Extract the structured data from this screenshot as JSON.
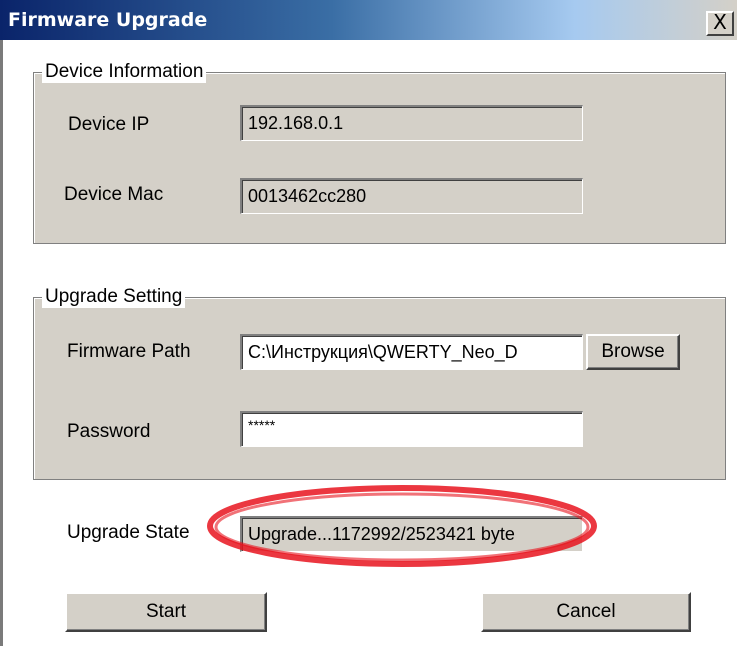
{
  "window": {
    "title": "Firmware Upgrade",
    "close_glyph": "X"
  },
  "device_info": {
    "legend": "Device Information",
    "ip_label": "Device IP",
    "ip_value": "192.168.0.1",
    "mac_label": "Device Mac",
    "mac_value": "0013462cc280"
  },
  "upgrade_setting": {
    "legend": "Upgrade Setting",
    "path_label": "Firmware Path",
    "path_value": "C:\\Инструкция\\QWERTY_Neo_D",
    "browse_label": "Browse",
    "password_label": "Password",
    "password_value": "*****"
  },
  "state": {
    "label": "Upgrade State",
    "value": "Upgrade...1172992/2523421 byte",
    "bytes_done": 1172992,
    "bytes_total": 2523421,
    "highlight_color": "#e8141e"
  },
  "buttons": {
    "start_label": "Start",
    "cancel_label": "Cancel"
  },
  "colors": {
    "dialog_face": "#d4d0c8",
    "titlebar_active": "#0a246a"
  }
}
